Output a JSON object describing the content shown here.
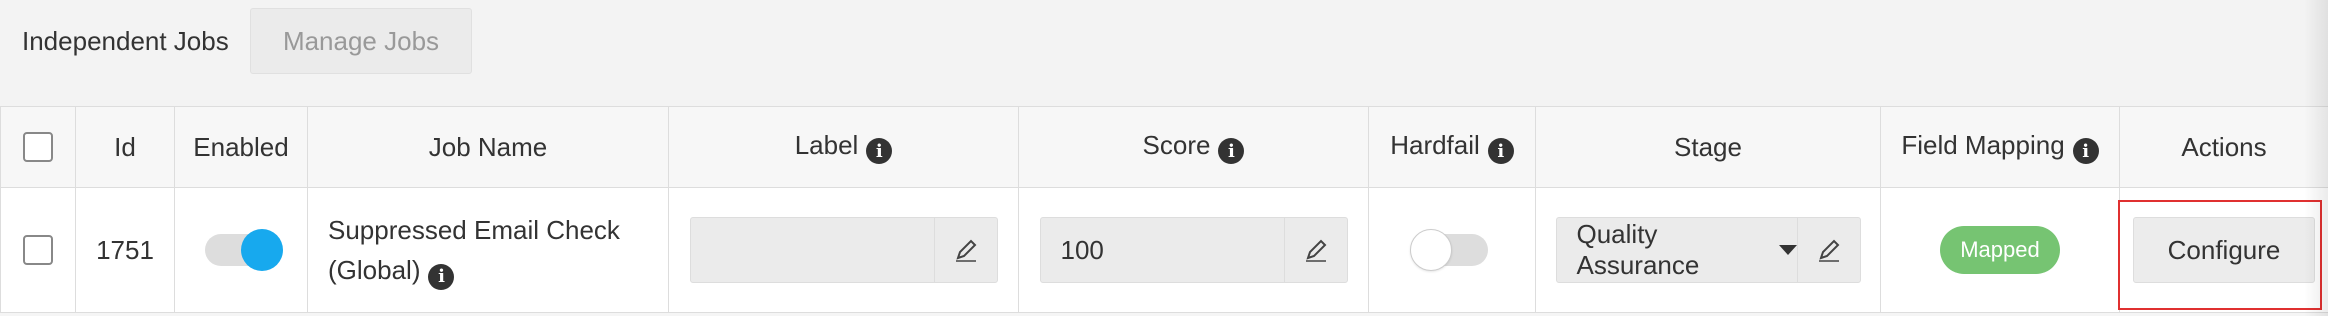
{
  "header": {
    "title": "Independent Jobs",
    "manage_button": "Manage Jobs"
  },
  "table": {
    "columns": {
      "id": "Id",
      "enabled": "Enabled",
      "job_name": "Job Name",
      "label": "Label",
      "score": "Score",
      "hardfail": "Hardfail",
      "stage": "Stage",
      "field_mapping": "Field Mapping",
      "actions": "Actions"
    },
    "rows": [
      {
        "id": "1751",
        "enabled": true,
        "job_name_line1": "Suppressed Email Check",
        "job_name_line2": "(Global)",
        "label": "",
        "score": "100",
        "hardfail": false,
        "stage": "Quality Assurance",
        "field_mapping": "Mapped",
        "action": "Configure"
      }
    ]
  },
  "icons": {
    "info": "info-icon",
    "edit": "pencil-icon",
    "dropdown": "caret-down-icon"
  },
  "colors": {
    "toggle_on": "#17a9ee",
    "mapped_badge": "#76c472",
    "highlight": "#e03030"
  }
}
